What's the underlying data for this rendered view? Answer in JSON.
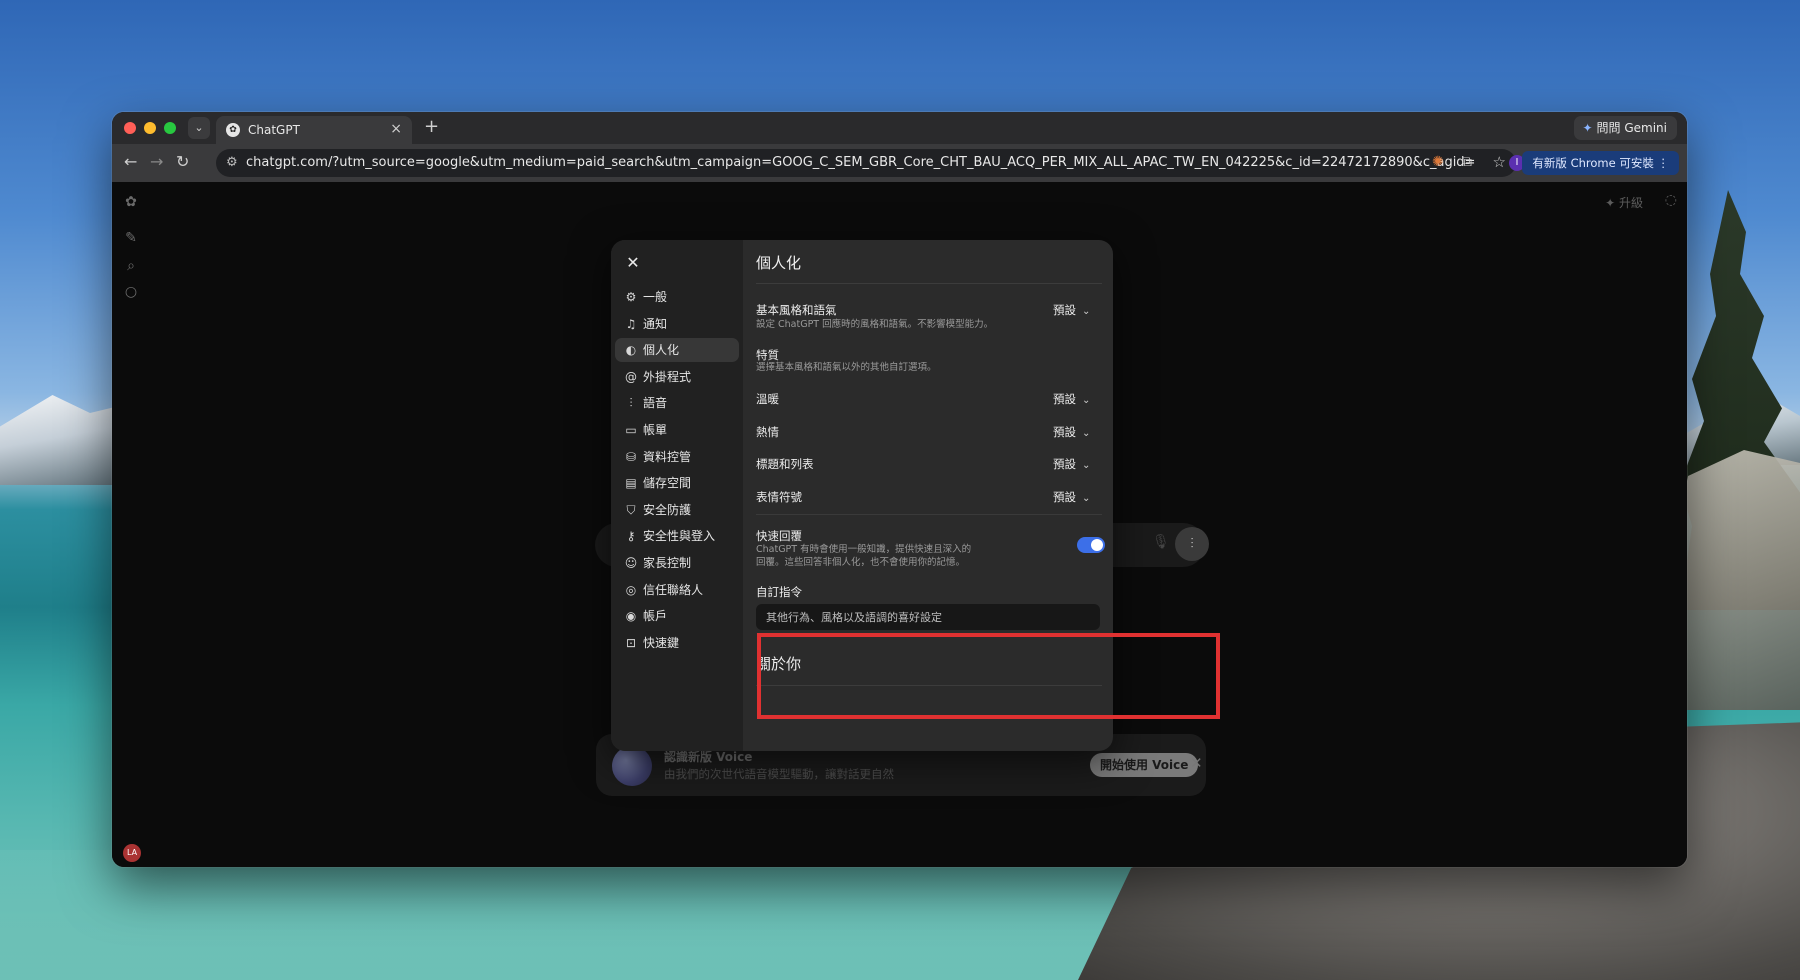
{
  "browser": {
    "tab_title": "ChatGPT",
    "gemini_label": "問問 Gemini",
    "url": "chatgpt.com/?utm_source=google&utm_medium=paid_search&utm_campaign=GOOG_C_SEM_GBR_Core_CHT_BAU_ACQ_PER_MIX_ALL_APAC_TW_EN_042225&c_id=22472172890&c_agid=17806...",
    "profile_initial": "I",
    "update_label": "有新版 Chrome 可安裝"
  },
  "app": {
    "upgrade_label": "升級",
    "user_initials": "LA"
  },
  "promo": {
    "title": "認識新版 Voice",
    "subtitle": "由我們的次世代語音模型驅動，讓對話更自然",
    "button": "開始使用 Voice"
  },
  "settings": {
    "nav": [
      {
        "label": "一般",
        "icon": "gear-icon"
      },
      {
        "label": "通知",
        "icon": "bell-icon"
      },
      {
        "label": "個人化",
        "icon": "personalization-icon",
        "active": true
      },
      {
        "label": "外掛程式",
        "icon": "at-icon"
      },
      {
        "label": "語音",
        "icon": "waveform-icon"
      },
      {
        "label": "帳單",
        "icon": "card-icon"
      },
      {
        "label": "資料控管",
        "icon": "database-icon"
      },
      {
        "label": "儲存空間",
        "icon": "storage-icon"
      },
      {
        "label": "安全防護",
        "icon": "shield-icon"
      },
      {
        "label": "安全性與登入",
        "icon": "key-icon"
      },
      {
        "label": "家長控制",
        "icon": "family-icon"
      },
      {
        "label": "信任聯絡人",
        "icon": "contact-icon"
      },
      {
        "label": "帳戶",
        "icon": "account-icon"
      },
      {
        "label": "快速鍵",
        "icon": "keyboard-icon"
      }
    ],
    "title": "個人化",
    "style": {
      "title": "基本風格和語氣",
      "desc": "設定 ChatGPT 回應時的風格和語氣。不影響模型能力。",
      "value": "預設"
    },
    "traits": {
      "title": "特質",
      "desc": "選擇基本風格和語氣以外的其他自訂選項。"
    },
    "trait_rows": [
      {
        "label": "溫暖",
        "value": "預設"
      },
      {
        "label": "熱情",
        "value": "預設"
      },
      {
        "label": "標題和列表",
        "value": "預設"
      },
      {
        "label": "表情符號",
        "value": "預設"
      }
    ],
    "quick_reply": {
      "title": "快速回覆",
      "desc_line1": "ChatGPT 有時會使用一般知識，提供快速且深入的",
      "desc_line2": "回覆。這些回答非個人化，也不會使用你的記憶。",
      "enabled": true
    },
    "custom_instructions": {
      "label": "自訂指令",
      "placeholder": "其他行為、風格以及語調的喜好設定"
    },
    "about_you": "關於你"
  },
  "colors": {
    "toggle_on": "#3c6fe8",
    "highlight": "#e03131"
  }
}
